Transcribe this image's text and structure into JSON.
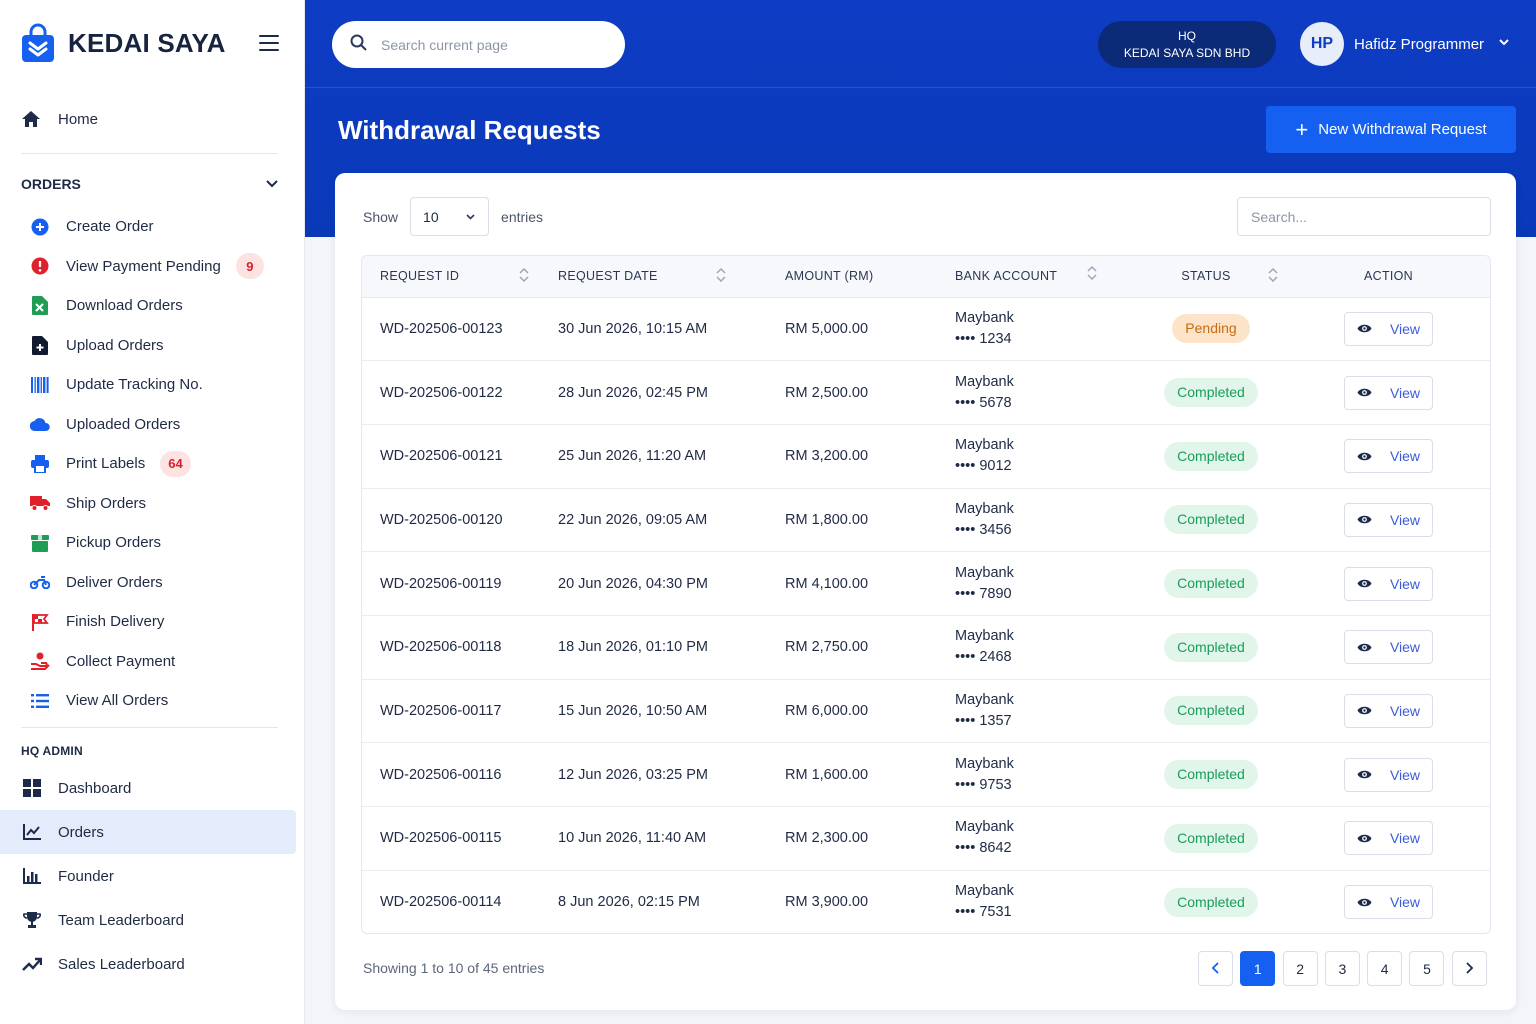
{
  "brand": {
    "name": "KEDAI SAYA"
  },
  "sidebar": {
    "home_label": "Home",
    "orders_section": "ORDERS",
    "orders_items": [
      {
        "label": "Create Order",
        "icon": "plus-circle-icon"
      },
      {
        "label": "View Payment Pending",
        "icon": "alert-circle-icon",
        "badge": "9"
      },
      {
        "label": "Download Orders",
        "icon": "excel-file-icon"
      },
      {
        "label": "Upload Orders",
        "icon": "file-upload-icon"
      },
      {
        "label": "Update Tracking No.",
        "icon": "barcode-icon"
      },
      {
        "label": "Uploaded Orders",
        "icon": "cloud-icon"
      },
      {
        "label": "Print Labels",
        "icon": "printer-icon",
        "badge": "64"
      },
      {
        "label": "Ship Orders",
        "icon": "truck-icon"
      },
      {
        "label": "Pickup Orders",
        "icon": "box-icon"
      },
      {
        "label": "Deliver Orders",
        "icon": "motorbike-icon"
      },
      {
        "label": "Finish Delivery",
        "icon": "finish-flag-icon"
      },
      {
        "label": "Collect Payment",
        "icon": "hand-coin-icon"
      },
      {
        "label": "View All Orders",
        "icon": "list-icon"
      }
    ],
    "hq_section": "HQ ADMIN",
    "admin_items": [
      {
        "label": "Dashboard",
        "icon": "dashboard-grid-icon"
      },
      {
        "label": "Orders",
        "icon": "line-chart-icon",
        "active": true
      },
      {
        "label": "Founder",
        "icon": "bar-chart-icon"
      },
      {
        "label": "Team Leaderboard",
        "icon": "trophy-icon"
      },
      {
        "label": "Sales Leaderboard",
        "icon": "trending-up-icon"
      }
    ]
  },
  "header": {
    "search_placeholder": "Search current page",
    "org_line1": "HQ",
    "org_line2": "KEDAI SAYA SDN BHD",
    "user_initials": "HP",
    "user_name": "Hafidz Programmer"
  },
  "page": {
    "title": "Withdrawal Requests",
    "new_button": "New Withdrawal Request"
  },
  "table_controls": {
    "show_label": "Show",
    "entries_value": "10",
    "entries_label": "entries",
    "search_placeholder": "Search..."
  },
  "table": {
    "columns": [
      "REQUEST ID",
      "REQUEST DATE",
      "AMOUNT (RM)",
      "BANK ACCOUNT",
      "STATUS",
      "ACTION"
    ],
    "view_label": "View",
    "rows": [
      {
        "id": "WD-202506-00123",
        "date": "30 Jun 2026, 10:15 AM",
        "amount": "RM 5,000.00",
        "bank": "Maybank",
        "account": "•••• 1234",
        "status": "Pending"
      },
      {
        "id": "WD-202506-00122",
        "date": "28 Jun 2026, 02:45 PM",
        "amount": "RM 2,500.00",
        "bank": "Maybank",
        "account": "•••• 5678",
        "status": "Completed"
      },
      {
        "id": "WD-202506-00121",
        "date": "25 Jun 2026, 11:20 AM",
        "amount": "RM 3,200.00",
        "bank": "Maybank",
        "account": "•••• 9012",
        "status": "Completed"
      },
      {
        "id": "WD-202506-00120",
        "date": "22 Jun 2026, 09:05 AM",
        "amount": "RM 1,800.00",
        "bank": "Maybank",
        "account": "•••• 3456",
        "status": "Completed"
      },
      {
        "id": "WD-202506-00119",
        "date": "20 Jun 2026, 04:30 PM",
        "amount": "RM 4,100.00",
        "bank": "Maybank",
        "account": "•••• 7890",
        "status": "Completed"
      },
      {
        "id": "WD-202506-00118",
        "date": "18 Jun 2026, 01:10 PM",
        "amount": "RM 2,750.00",
        "bank": "Maybank",
        "account": "•••• 2468",
        "status": "Completed"
      },
      {
        "id": "WD-202506-00117",
        "date": "15 Jun 2026, 10:50 AM",
        "amount": "RM 6,000.00",
        "bank": "Maybank",
        "account": "•••• 1357",
        "status": "Completed"
      },
      {
        "id": "WD-202506-00116",
        "date": "12 Jun 2026, 03:25 PM",
        "amount": "RM 1,600.00",
        "bank": "Maybank",
        "account": "•••• 9753",
        "status": "Completed"
      },
      {
        "id": "WD-202506-00115",
        "date": "10 Jun 2026, 11:40 AM",
        "amount": "RM 2,300.00",
        "bank": "Maybank",
        "account": "•••• 8642",
        "status": "Completed"
      },
      {
        "id": "WD-202506-00114",
        "date": "8 Jun 2026, 02:15 PM",
        "amount": "RM 3,900.00",
        "bank": "Maybank",
        "account": "•••• 7531",
        "status": "Completed"
      }
    ]
  },
  "footer": {
    "info": "Showing 1 to 10 of 45 entries",
    "pages": [
      "1",
      "2",
      "3",
      "4",
      "5"
    ],
    "current_page": "1"
  },
  "colors": {
    "primary": "#0e3cc4",
    "accent": "#1560f0",
    "pending": "#c76a12",
    "completed": "#1a9d5a",
    "badge": "#d8202a"
  }
}
